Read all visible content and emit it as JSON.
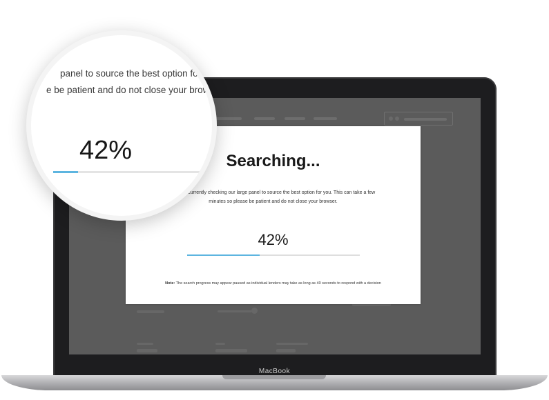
{
  "device": {
    "brand": "MacBook"
  },
  "modal": {
    "title": "Searching...",
    "message_line1": "We are currently checking our large panel to source the best option for you. This can take a few",
    "message_line2": "minutes so please be patient and do not close your browser.",
    "progress_percent_label": "42%",
    "progress_value": 0.42,
    "note_label": "Note:",
    "note_text": "The search progress may appear paused as individual lenders may take as long as 40 seconds to respond with a decision"
  },
  "magnifier": {
    "line1": "panel to source the best option fo",
    "line2": "e be patient and do not close your brows",
    "percent_label": "42%",
    "progress_value": 0.42
  },
  "colors": {
    "accent": "#5db5e0",
    "overlay": "#5b5b5b",
    "laptop": "#1d1d1f"
  }
}
